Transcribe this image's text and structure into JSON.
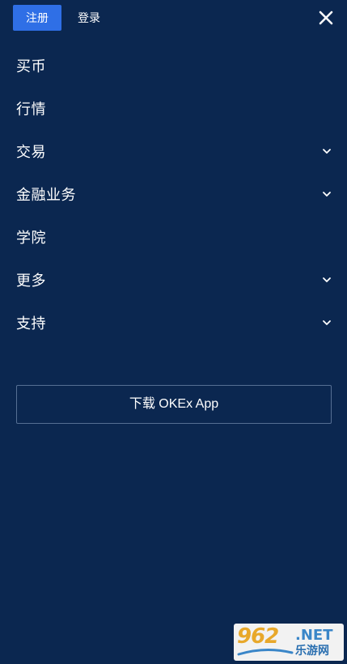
{
  "header": {
    "register_label": "注册",
    "login_label": "登录",
    "close_icon": "close-icon"
  },
  "menu": {
    "items": [
      {
        "label": "买币",
        "has_chevron": false
      },
      {
        "label": "行情",
        "has_chevron": false
      },
      {
        "label": "交易",
        "has_chevron": true
      },
      {
        "label": "金融业务",
        "has_chevron": true
      },
      {
        "label": "学院",
        "has_chevron": false
      },
      {
        "label": "更多",
        "has_chevron": true
      },
      {
        "label": "支持",
        "has_chevron": true
      }
    ]
  },
  "download": {
    "label": "下载 OKEx App"
  },
  "watermark": {
    "logo": "962",
    "net": ".NET",
    "sub": "乐游网"
  },
  "colors": {
    "background": "#0b2750",
    "accent": "#2f6fe6",
    "border": "#566f93"
  }
}
